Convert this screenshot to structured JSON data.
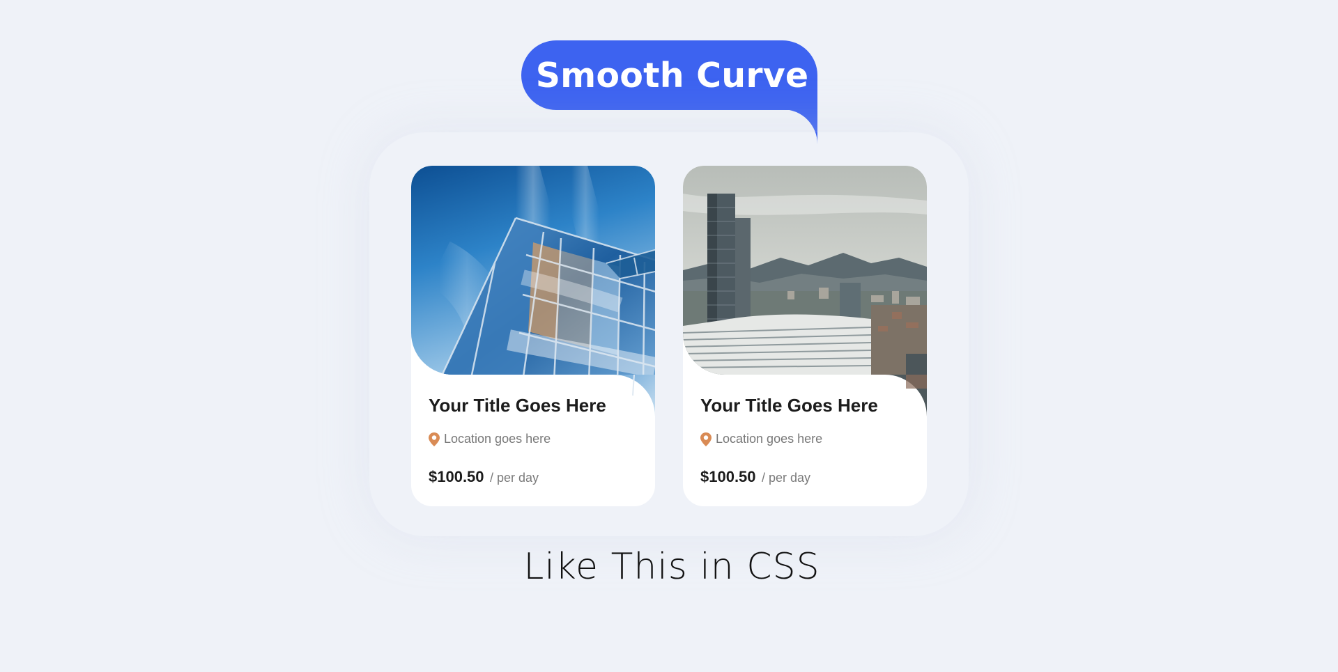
{
  "header": {
    "badge_label": "Smooth Curve",
    "badge_color": "#3d63f0"
  },
  "cards": [
    {
      "image": "glass-building-photo",
      "title": "Your Title Goes Here",
      "location": "Location goes here",
      "location_icon": "map-pin-icon",
      "price": "$100.50",
      "price_unit": "/ per day"
    },
    {
      "image": "city-skyline-photo",
      "title": "Your Title Goes Here",
      "location": "Location goes here",
      "location_icon": "map-pin-icon",
      "price": "$100.50",
      "price_unit": "/ per day"
    }
  ],
  "caption": "Like This in CSS",
  "colors": {
    "background": "#eff2f8",
    "accent_pin": "#d98b55",
    "card": "#ffffff"
  }
}
